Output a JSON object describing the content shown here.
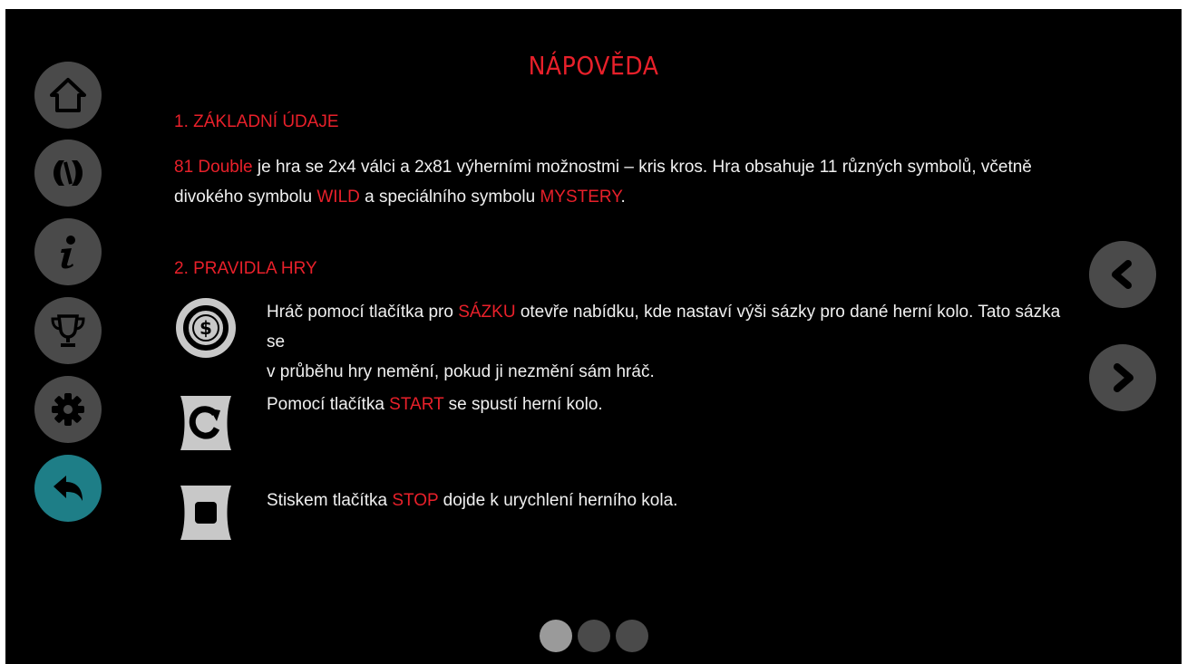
{
  "page": {
    "title": "NÁPOVĚDA"
  },
  "sidebar": {
    "items": [
      {
        "name": "home",
        "icon": "home-icon"
      },
      {
        "name": "game-logo",
        "icon": "game-logo-icon"
      },
      {
        "name": "info",
        "icon": "info-icon"
      },
      {
        "name": "trophy",
        "icon": "trophy-icon"
      },
      {
        "name": "settings",
        "icon": "gear-icon"
      },
      {
        "name": "back",
        "icon": "back-arrow-icon"
      }
    ],
    "back_color": "#1e7e87",
    "button_color": "#4a4a4a"
  },
  "section1": {
    "heading": "1. ZÁKLADNÍ ÚDAJE",
    "line1_game": "81 Double",
    "line1_rest": " je hra se 2x4 válci a 2x81 výherními možnostmi – kris kros. Hra obsahuje 11 různých symbolů, včetně",
    "line2_a": "divokého symbolu ",
    "line2_wild": "WILD",
    "line2_b": " a speciálního symbolu ",
    "line2_mystery": "MYSTERY",
    "line2_c": "."
  },
  "section2": {
    "heading": "2. PRAVIDLA HRY",
    "bet": {
      "icon": "coin-bet-icon",
      "a": "Hráč pomocí tlačítka pro ",
      "keyword": "SÁZKU",
      "b": " otevře nabídku, kde nastaví výši sázky pro dané herní kolo. Tato sázka se",
      "line2": "v průběhu hry nemění, pokud ji nezmění sám hráč."
    },
    "start": {
      "icon": "start-spin-icon",
      "a": "Pomocí tlačítka ",
      "keyword": "START",
      "b": " se spustí herní kolo."
    },
    "stop": {
      "icon": "stop-icon",
      "a": "Stiskem tlačítka ",
      "keyword": "STOP",
      "b": " dojde k urychlení herního kola."
    }
  },
  "navigation": {
    "prev_icon": "chevron-left-icon",
    "next_icon": "chevron-right-icon",
    "pages": 3,
    "current_page": 1
  },
  "colors": {
    "accent": "#e8202a",
    "text": "#f0f0f0",
    "background": "#000000"
  }
}
